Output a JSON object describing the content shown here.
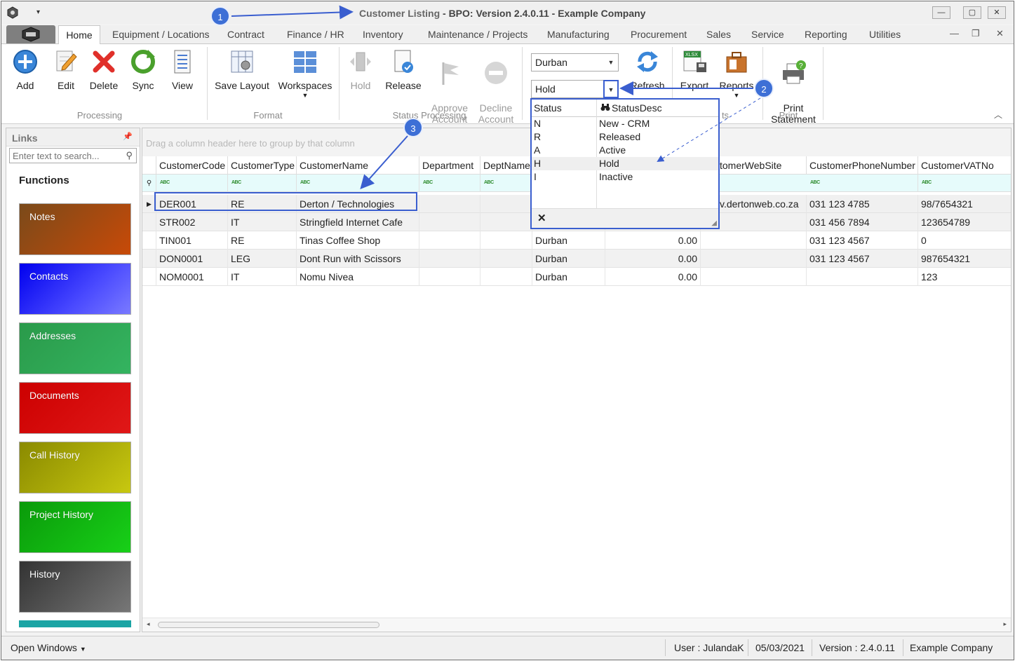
{
  "window": {
    "title_dim": "Customer Listing",
    "title_main": " - BPO: Version 2.4.0.11 - Example Company"
  },
  "tabs": [
    "Home",
    "Equipment / Locations",
    "Contract",
    "Finance / HR",
    "Inventory",
    "Maintenance / Projects",
    "Manufacturing",
    "Procurement",
    "Sales",
    "Service",
    "Reporting",
    "Utilities"
  ],
  "ribbon": {
    "processing": {
      "label": "Processing",
      "add": "Add",
      "edit": "Edit",
      "delete": "Delete",
      "sync": "Sync",
      "view": "View"
    },
    "format": {
      "label": "Format",
      "save_layout": "Save Layout",
      "workspaces": "Workspaces"
    },
    "status_processing": {
      "label": "Status Processing",
      "hold": "Hold",
      "release": "Release",
      "approve": "Approve\nAccount",
      "decline": "Decline\nAccount"
    },
    "location_combo": "Durban",
    "status_combo": "Hold",
    "refresh": "Refresh",
    "export": "Export",
    "reports": "Reports",
    "print": {
      "label": "Print",
      "statement": "Print\nStatement"
    },
    "ts": "ts"
  },
  "links": {
    "title": "Links",
    "search_placeholder": "Enter text to search...",
    "functions_title": "Functions",
    "items": [
      {
        "label": "Notes"
      },
      {
        "label": "Contacts"
      },
      {
        "label": "Addresses"
      },
      {
        "label": "Documents"
      },
      {
        "label": "Call History"
      },
      {
        "label": "Project History"
      },
      {
        "label": "History"
      }
    ]
  },
  "grid": {
    "group_hint": "Drag a column header here to group by that column",
    "columns": {
      "code": "CustomerCode",
      "type": "CustomerType",
      "name": "CustomerName",
      "dept": "Department",
      "deptname": "DeptName",
      "web": "tomerWebSite",
      "phone": "CustomerPhoneNumber",
      "vat": "CustomerVATNo"
    },
    "rows": [
      {
        "code": "DER001",
        "type": "RE",
        "name": "Derton / Technologies",
        "loc": "",
        "amount": "",
        "web": "v.dertonweb.co.za",
        "phone": "031 123 4785",
        "vat": "98/7654321"
      },
      {
        "code": "STR002",
        "type": "IT",
        "name": "Stringfield Internet Cafe",
        "loc": "",
        "amount": "",
        "web": "",
        "phone": "031 456 7894",
        "vat": "123654789"
      },
      {
        "code": "TIN001",
        "type": "RE",
        "name": "Tinas Coffee Shop",
        "loc": "Durban",
        "amount": "0.00",
        "web": "",
        "phone": "031 123 4567",
        "vat": "0"
      },
      {
        "code": "DON0001",
        "type": "LEG",
        "name": "Dont Run with Scissors",
        "loc": "Durban",
        "amount": "0.00",
        "web": "",
        "phone": "031 123 4567",
        "vat": "987654321"
      },
      {
        "code": "NOM0001",
        "type": "IT",
        "name": "Nomu Nivea",
        "loc": "Durban",
        "amount": "0.00",
        "web": "",
        "phone": "",
        "vat": "123"
      }
    ]
  },
  "popup": {
    "col_status": "Status",
    "col_desc": "StatusDesc",
    "rows": [
      {
        "status": "N",
        "desc": "New - CRM"
      },
      {
        "status": "R",
        "desc": "Released"
      },
      {
        "status": "A",
        "desc": "Active"
      },
      {
        "status": "H",
        "desc": "Hold"
      },
      {
        "status": "I",
        "desc": "Inactive"
      }
    ]
  },
  "callouts": [
    "1",
    "2",
    "3"
  ],
  "statusbar": {
    "open_windows": "Open Windows",
    "user": "User : JulandaK",
    "date": "05/03/2021",
    "version": "Version : 2.4.0.11",
    "company": "Example Company"
  },
  "colors": {
    "accent": "#3a5ecf",
    "notes": "#b54c10",
    "contacts": "#1a1aff",
    "addresses": "#2eaa5a",
    "documents": "#d80a0a",
    "call_history": "#a8aa08",
    "project_history": "#10c010",
    "history": "#555555"
  }
}
